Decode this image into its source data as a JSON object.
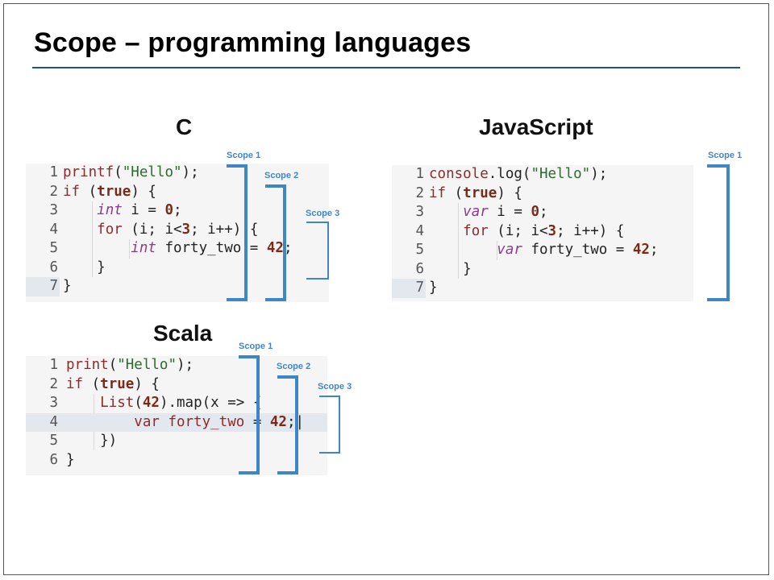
{
  "title": "Scope – programming languages",
  "colors": {
    "rule": "#1f4e9a",
    "scope": "#3f86c9"
  },
  "c": {
    "heading": "C",
    "lines": [
      "1",
      "2",
      "3",
      "4",
      "5",
      "6",
      "7"
    ],
    "scopes": [
      "Scope 1",
      "Scope 2",
      "Scope 3"
    ]
  },
  "js": {
    "heading": "JavaScript",
    "lines": [
      "1",
      "2",
      "3",
      "4",
      "5",
      "6",
      "7"
    ],
    "scopes": [
      "Scope 1"
    ]
  },
  "scala": {
    "heading": "Scala",
    "lines": [
      "1",
      "2",
      "3",
      "4",
      "5",
      "6"
    ],
    "scopes": [
      "Scope 1",
      "Scope 2",
      "Scope 3"
    ]
  }
}
